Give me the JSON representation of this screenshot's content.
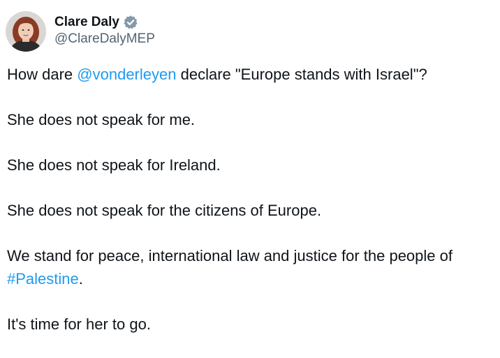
{
  "author": {
    "display_name": "Clare Daly",
    "handle": "@ClareDalyMEP",
    "verified_icon": "verified-badge-icon",
    "verified_color": "#829aab"
  },
  "tweet": {
    "line1": {
      "before": "How dare ",
      "mention": "@vonderleyen",
      "after": " declare \"Europe stands with Israel\"?"
    },
    "line2": "She does not speak for me.",
    "line3": "She does not speak for Ireland.",
    "line4": "She does not speak for the citizens of Europe.",
    "line5": {
      "before": "We stand for peace, international law and justice for the people of ",
      "hashtag": "#Palestine",
      "after": "."
    },
    "line6": "It's time for her to go."
  },
  "colors": {
    "text": "#0f1419",
    "secondary": "#536471",
    "link": "#1d9bf0"
  }
}
